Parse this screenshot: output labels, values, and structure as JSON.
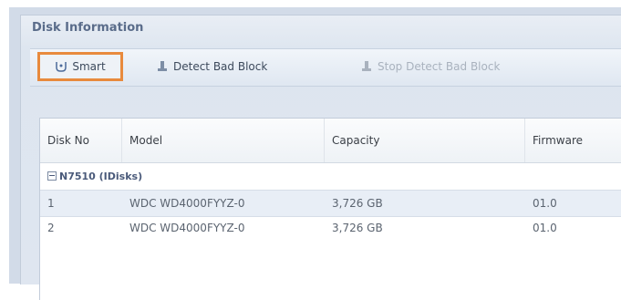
{
  "panel": {
    "title": "Disk Information"
  },
  "toolbar": {
    "smart_label": "Smart",
    "detect_label": "Detect Bad Block",
    "stop_label": "Stop Detect Bad Block"
  },
  "grid": {
    "columns": [
      "Disk No",
      "Model",
      "Capacity",
      "Firmware"
    ],
    "group_label": "N7510 (IDisks)",
    "rows": [
      {
        "disk_no": "1",
        "model": "WDC WD4000FYYZ-0",
        "capacity": "3,726 GB",
        "firmware": "01.0"
      },
      {
        "disk_no": "2",
        "model": "WDC WD4000FYYZ-0",
        "capacity": "3,726 GB",
        "firmware": "01.0"
      }
    ]
  },
  "colors": {
    "highlight": "#e88a3d",
    "selected_row": "#e8eef6",
    "panel_bg": "#dde5ef"
  },
  "icons": [
    "smart-icon",
    "detect-bad-block-icon",
    "stop-detect-icon"
  ]
}
